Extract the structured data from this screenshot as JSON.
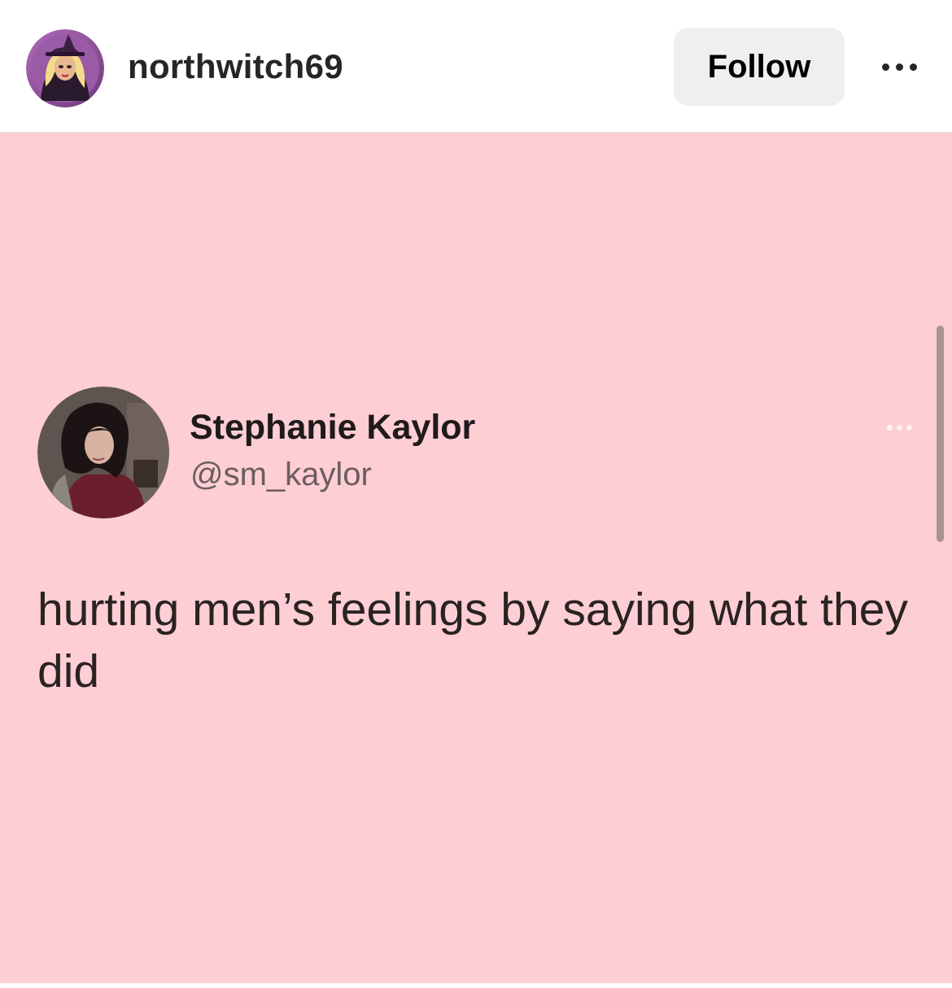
{
  "header": {
    "username": "northwitch69",
    "follow_label": "Follow",
    "more_icon": "more-horizontal-icon"
  },
  "post": {
    "background_color": "#fdced3",
    "tweet": {
      "name": "Stephanie Kaylor",
      "handle": "@sm_kaylor",
      "text": "hurting men’s feelings by saying what they did",
      "more_icon": "more-horizontal-icon"
    }
  }
}
